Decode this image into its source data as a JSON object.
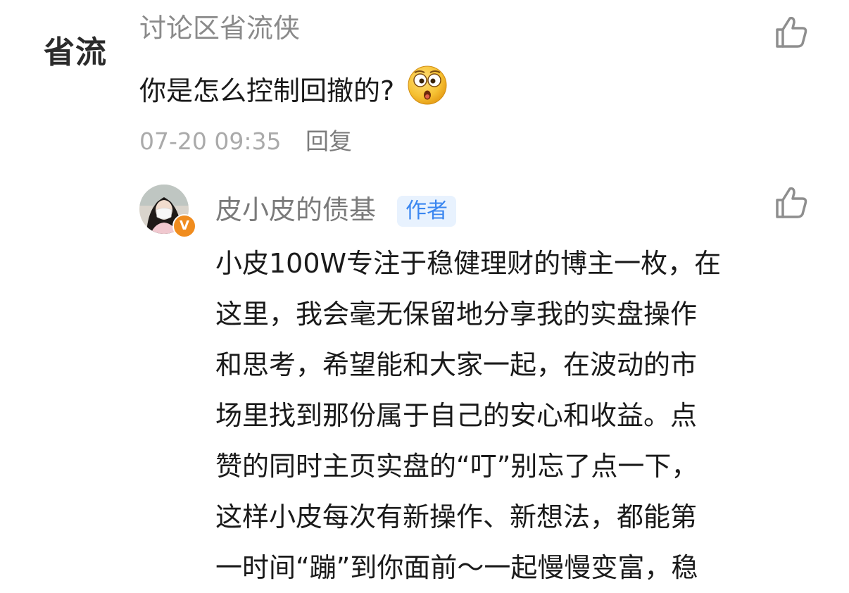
{
  "comment": {
    "avatar_text": "省流",
    "username": "讨论区省流侠",
    "text": "你是怎么控制回撤的?",
    "emoji": "shocked-face-emoji",
    "time": "07-20 09:35",
    "reply_label": "回复"
  },
  "reply": {
    "username": "皮小皮的债基",
    "badge": "作者",
    "verified": "V",
    "lines": [
      "小皮100W专注于稳健理财的博主一枚，在",
      "这里，我会毫无保留地分享我的实盘操作",
      "和思考，希望能和大家一起，在波动的市",
      "场里找到那份属于自己的安心和收益。点",
      "赞的同时主页实盘的“叮”别忘了点一下，",
      "这样小皮每次有新操作、新想法，都能第",
      "一时间“蹦”到你面前～一起慢慢变富，稳"
    ]
  },
  "icons": {
    "like": "thumbs-up-icon",
    "verified": "verified-badge-icon"
  },
  "colors": {
    "author_badge_bg": "#e8f2fe",
    "author_badge_text": "#3a86f0",
    "verified_badge": "#f08c1e"
  }
}
